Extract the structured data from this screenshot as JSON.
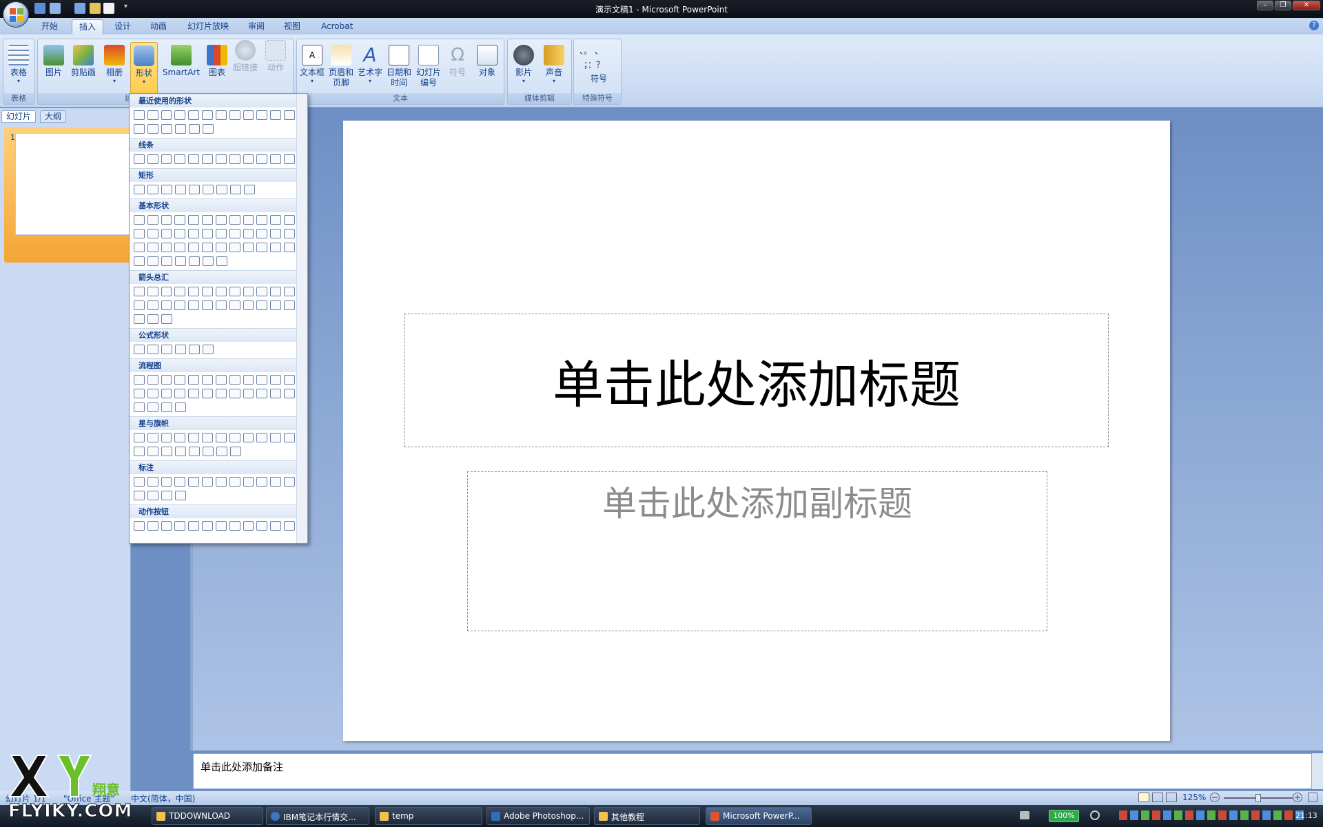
{
  "window": {
    "title": "演示文稿1 - Microsoft PowerPoint"
  },
  "tabs": [
    {
      "label": "开始"
    },
    {
      "label": "插入"
    },
    {
      "label": "设计"
    },
    {
      "label": "动画"
    },
    {
      "label": "幻灯片放映"
    },
    {
      "label": "审阅"
    },
    {
      "label": "视图"
    },
    {
      "label": "Acrobat"
    }
  ],
  "ribbon": {
    "tables": {
      "table": "表格",
      "group": "表格"
    },
    "illustrations": {
      "picture": "图片",
      "clipart": "剪贴画",
      "album": "相册",
      "shapes": "形状",
      "smartart": "SmartArt",
      "chart": "图表",
      "group_fragment": "插"
    },
    "links": {
      "hyperlink": "超链接",
      "action": "动作"
    },
    "text": {
      "textbox": "文本框",
      "header_footer_1": "页眉和",
      "header_footer_2": "页脚",
      "wordart": "艺术字",
      "datetime_1": "日期和",
      "datetime_2": "时间",
      "slidenum_1": "幻灯片",
      "slidenum_2": "编号",
      "symbol": "符号",
      "object": "对象",
      "group": "文本"
    },
    "media": {
      "movie": "影片",
      "sound": "声音",
      "group": "媒体剪辑"
    },
    "special": {
      "symbols_row1": "、。 、",
      "symbols_row2": "；：？",
      "symbol_button": "符号",
      "group": "特殊符号"
    }
  },
  "shapes_gallery": {
    "sections": [
      {
        "title": "最近使用的形状"
      },
      {
        "title": "线条"
      },
      {
        "title": "矩形"
      },
      {
        "title": "基本形状"
      },
      {
        "title": "箭头总汇"
      },
      {
        "title": "公式形状"
      },
      {
        "title": "流程图"
      },
      {
        "title": "星与旗帜"
      },
      {
        "title": "标注"
      },
      {
        "title": "动作按钮"
      }
    ]
  },
  "left_pane": {
    "tab_slides": "幻灯片",
    "tab_outline": "大纲",
    "slide_number": "1"
  },
  "slide": {
    "title_placeholder": "单击此处添加标题",
    "subtitle_placeholder": "单击此处添加副标题"
  },
  "notes": {
    "placeholder": "单击此处添加备注"
  },
  "status": {
    "slide_info": "幻灯片 1/1",
    "theme": "\"Office 主题\"",
    "language": "中文(简体，中国)",
    "zoom": "125%"
  },
  "taskbar": {
    "items": [
      {
        "label": "TDDOWNLOAD"
      },
      {
        "label": "IBM笔记本行情交..."
      },
      {
        "label": "temp"
      },
      {
        "label": "Adobe Photoshop..."
      },
      {
        "label": "其他教程"
      },
      {
        "label": "Microsoft PowerP..."
      }
    ],
    "battery": "100%",
    "time": "21:13"
  },
  "watermark": {
    "brand": "FLYIKY.COM",
    "logo_text": "翔意"
  },
  "colors": {
    "accent": "#15428b",
    "ribbon": "#cfdff4",
    "active_button": "#ffc94a"
  }
}
